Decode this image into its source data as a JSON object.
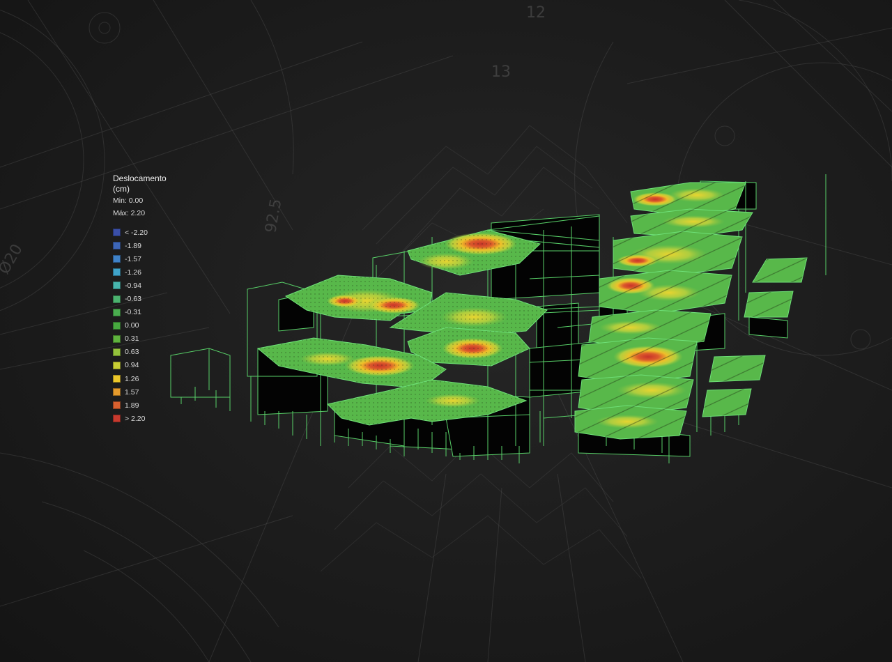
{
  "legend": {
    "title_line1": "Deslocamento",
    "title_line2": "(cm)",
    "min_label": "Min: 0.00",
    "max_label": "Máx: 2.20",
    "items": [
      {
        "label": "< -2.20",
        "color": "#3a4fa8"
      },
      {
        "label": "-1.89",
        "color": "#3d66b8"
      },
      {
        "label": "-1.57",
        "color": "#3f82c8"
      },
      {
        "label": "-1.26",
        "color": "#3fa3c9"
      },
      {
        "label": "-0.94",
        "color": "#47b5ad"
      },
      {
        "label": "-0.63",
        "color": "#4bb26e"
      },
      {
        "label": "-0.31",
        "color": "#4aad4f"
      },
      {
        "label": "0.00",
        "color": "#47a83f"
      },
      {
        "label": "0.31",
        "color": "#5fb23e"
      },
      {
        "label": "0.63",
        "color": "#94c23c"
      },
      {
        "label": "0.94",
        "color": "#c9cf34"
      },
      {
        "label": "1.26",
        "color": "#ecc72a"
      },
      {
        "label": "1.57",
        "color": "#e49a2c"
      },
      {
        "label": "1.89",
        "color": "#d8602f"
      },
      {
        "label": "> 2.20",
        "color": "#c83a2e"
      }
    ]
  }
}
